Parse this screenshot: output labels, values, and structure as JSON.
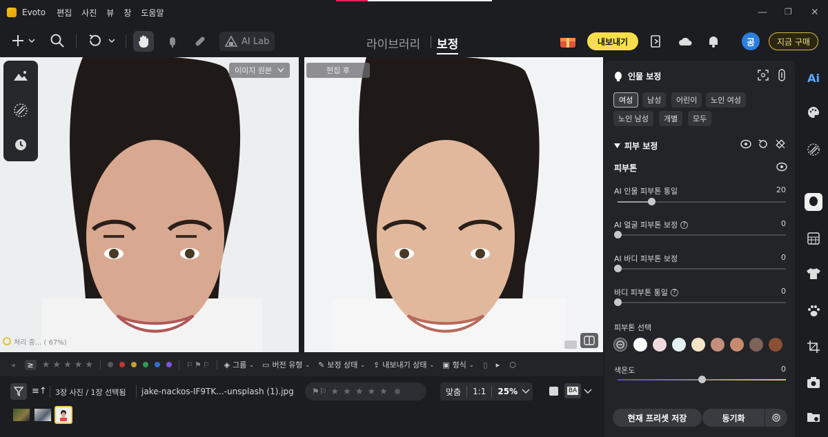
{
  "app": {
    "name": "Evoto"
  },
  "menu": [
    "편집",
    "사진",
    "뷰",
    "창",
    "도움말"
  ],
  "toolbar": {
    "ai_lab": "AI Lab"
  },
  "nav": {
    "library": "라이브러리",
    "edit": "보정"
  },
  "header": {
    "export": "내보내기",
    "buy": "지금 구매",
    "avatar": "공"
  },
  "compare": {
    "before_label": "이미지 원본",
    "after_label": "편집 후",
    "loading": "처리 중... ( 67%)"
  },
  "filterbar": {
    "rating_op": "≥",
    "group": "그룹",
    "version": "버전 유형",
    "edit_status": "보정 상태",
    "export_status": "내보내기 상태",
    "format": "형식",
    "color_labels": [
      "#c0392b",
      "#c8a030",
      "#2e9e4e",
      "#2f6fd0",
      "#7f55d8"
    ]
  },
  "statusbar": {
    "count": "3장 사진 / 1장 선택됨",
    "filename": "jake-nackos-IF9TK...-unsplash (1).jpg",
    "fit": "맞춤",
    "one_to_one": "1:1",
    "zoom": "25%",
    "ba": "BA"
  },
  "panel": {
    "title": "인물 보정",
    "chips": [
      "여성",
      "남성",
      "어린이",
      "노인 여성",
      "노인 남성",
      "개별",
      "모두"
    ],
    "skin_section": "피부 보정",
    "skintone_heading": "피부톤",
    "sliders": [
      {
        "label": "AI 인물 피부톤 통일",
        "value": "20",
        "fraction": 0.2
      },
      {
        "label": "AI 얼굴 피부톤 보정",
        "value": "0",
        "fraction": 0
      },
      {
        "label": "AI 바디 피부톤 보정",
        "value": "0",
        "fraction": 0
      },
      {
        "label": "바디 피부톤 통일",
        "value": "0",
        "fraction": 0
      }
    ],
    "skin_select": "피부톤 선택",
    "swatches": [
      "#ffffff",
      "#f0d8dc",
      "#e4f1f4",
      "#f7e3c8",
      "#c48e7d",
      "#c78a6e",
      "#7e6359",
      "#8a4f35"
    ],
    "saturation": {
      "label": "색온도",
      "value": "0",
      "fraction": 0.5
    },
    "save_preset": "현재 프리셋 저장",
    "sync": "동기화"
  }
}
